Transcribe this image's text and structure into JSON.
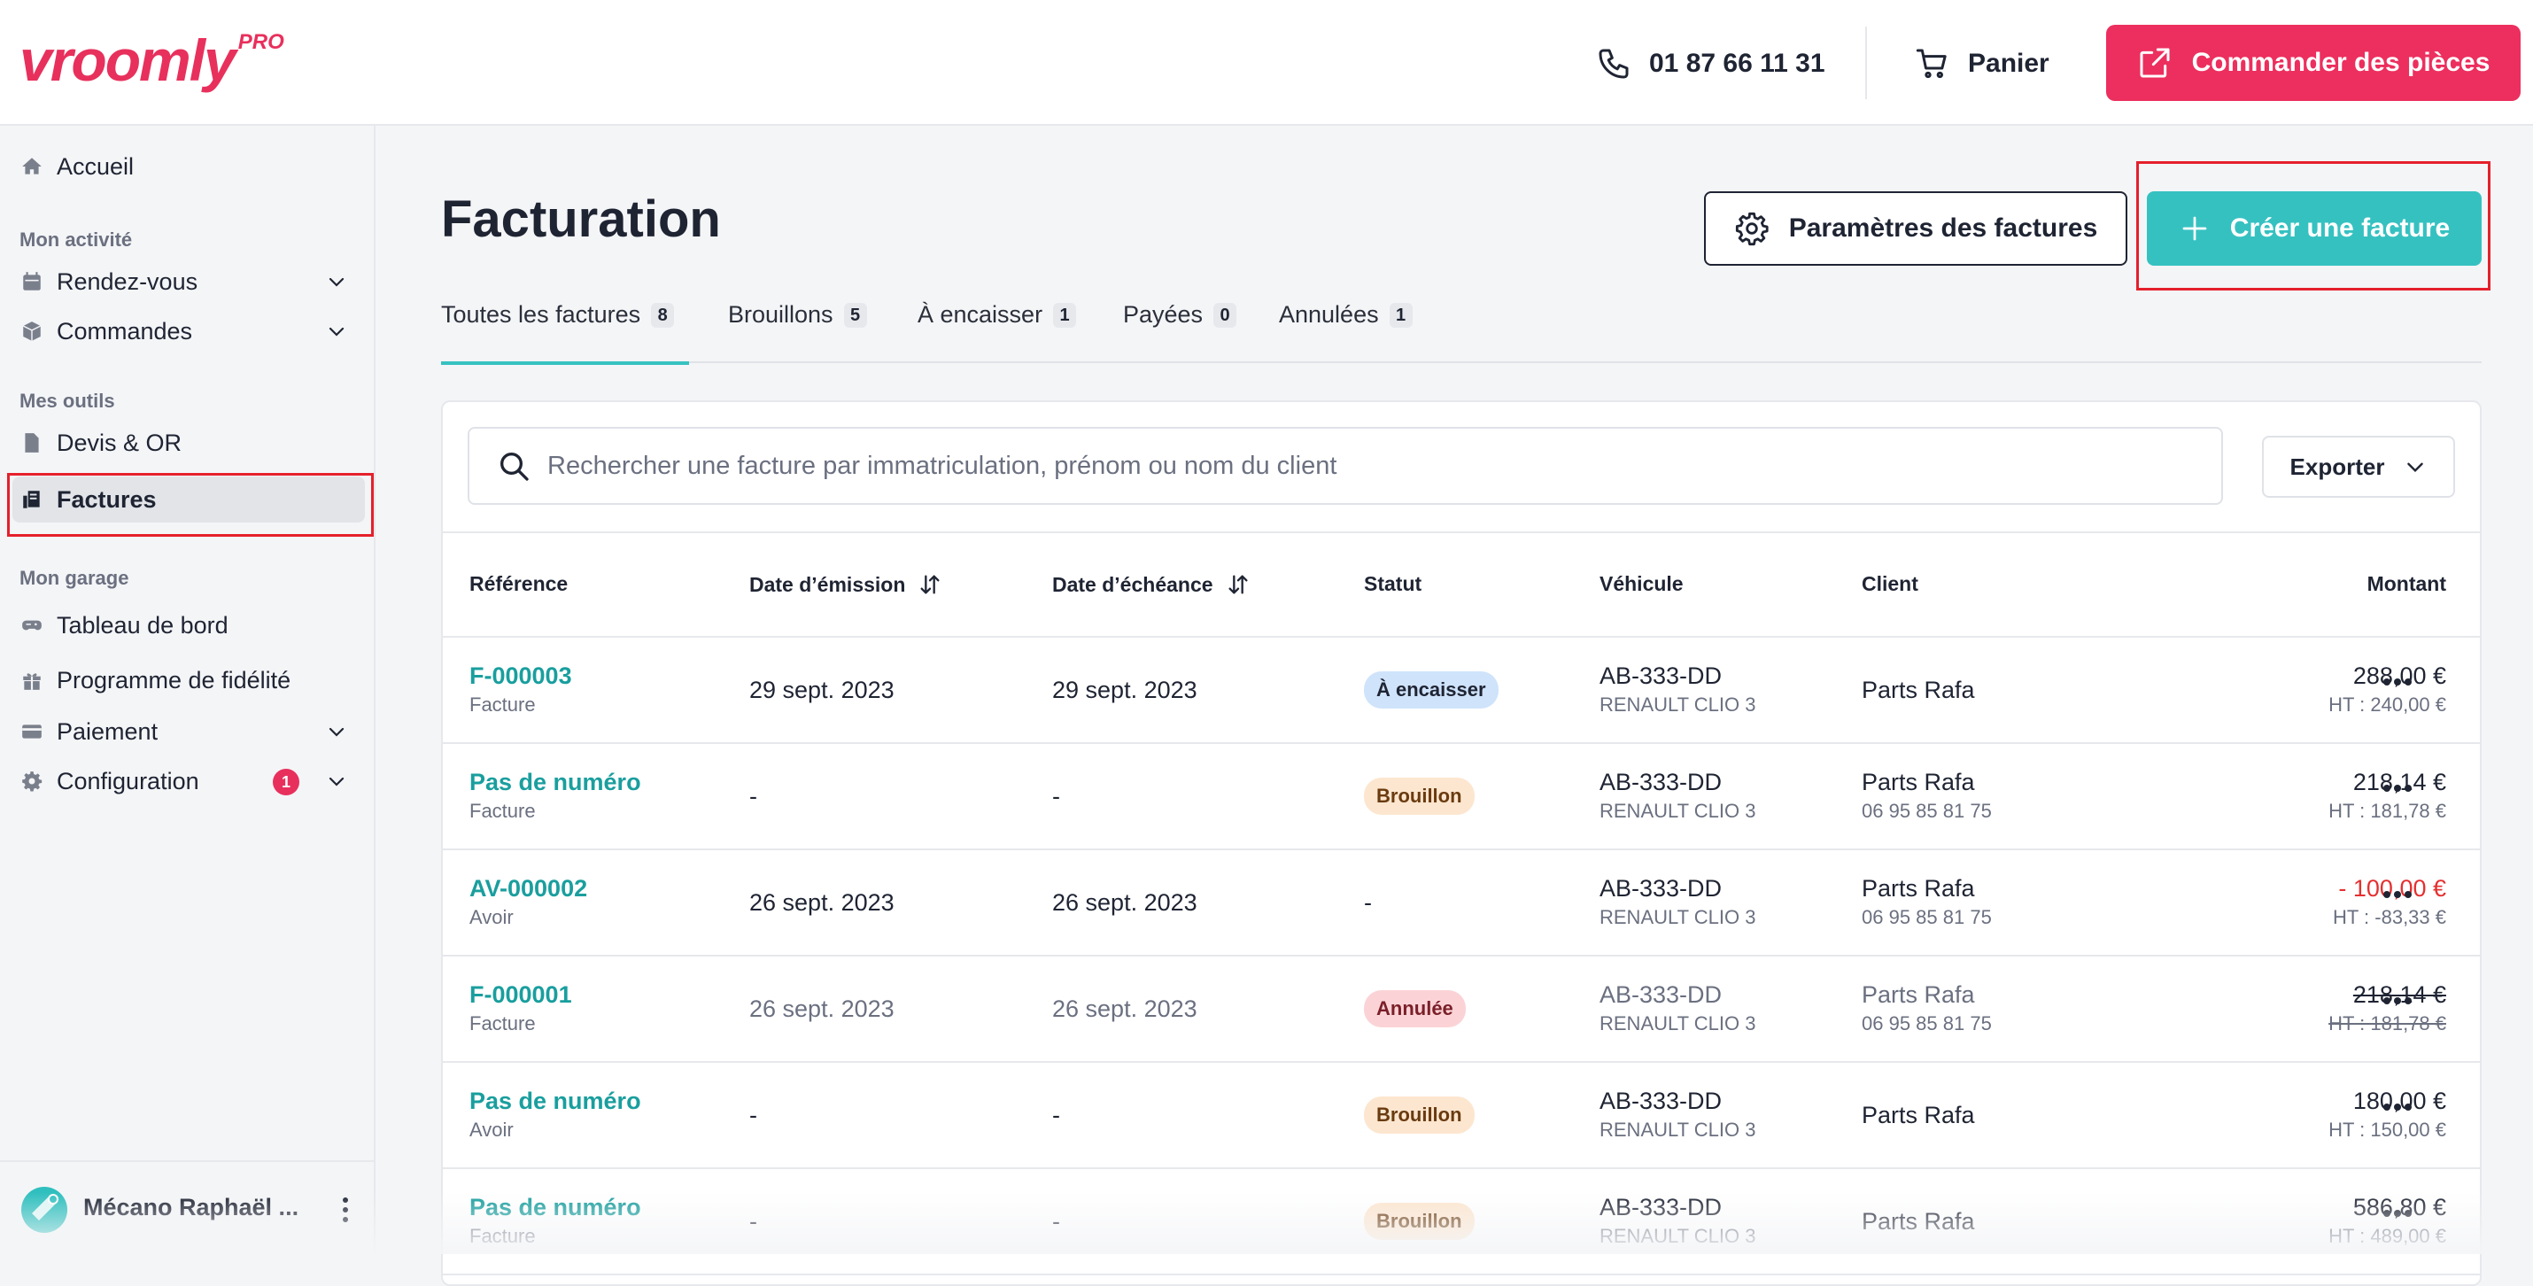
{
  "brand": {
    "name": "vroomly",
    "suffix": "PRO"
  },
  "header": {
    "phone": "01 87 66 11 31",
    "cart_label": "Panier",
    "order_label": "Commander des pièces"
  },
  "sidebar": {
    "home": "Accueil",
    "section_activity": "Mon activité",
    "rdv": "Rendez-vous",
    "orders": "Commandes",
    "section_tools": "Mes outils",
    "quotes": "Devis & OR",
    "invoices": "Factures",
    "section_garage": "Mon garage",
    "dashboard": "Tableau de bord",
    "loyalty": "Programme de fidélité",
    "payment": "Paiement",
    "config": "Configuration",
    "config_badge": "1",
    "user_name": "Mécano Raphaël ..."
  },
  "page": {
    "title": "Facturation",
    "params_label": "Paramètres des factures",
    "create_label": "Créer une facture"
  },
  "tabs": [
    {
      "label": "Toutes les factures",
      "count": "8"
    },
    {
      "label": "Brouillons",
      "count": "5"
    },
    {
      "label": "À encaisser",
      "count": "1"
    },
    {
      "label": "Payées",
      "count": "0"
    },
    {
      "label": "Annulées",
      "count": "1"
    }
  ],
  "search": {
    "placeholder": "Rechercher une facture par immatriculation, prénom ou nom du client"
  },
  "export_label": "Exporter",
  "table": {
    "headers": {
      "ref": "Référence",
      "issued": "Date d’émission",
      "due": "Date d’échéance",
      "status": "Statut",
      "vehicle": "Véhicule",
      "client": "Client",
      "amount": "Montant"
    },
    "rows": [
      {
        "ref": "F-000003",
        "type": "Facture",
        "issued": "29 sept. 2023",
        "due": "29 sept. 2023",
        "status": "À encaisser",
        "plate": "AB-333-DD",
        "model": "RENAULT CLIO 3",
        "client": "Parts Rafa",
        "phone": "",
        "amount": "288,00 €",
        "ht": "HT : 240,00 €"
      },
      {
        "ref": "Pas de numéro",
        "type": "Facture",
        "issued": "-",
        "due": "-",
        "status": "Brouillon",
        "plate": "AB-333-DD",
        "model": "RENAULT CLIO 3",
        "client": "Parts Rafa",
        "phone": "06 95 85 81 75",
        "amount": "218,14 €",
        "ht": "HT : 181,78 €"
      },
      {
        "ref": "AV-000002",
        "type": "Avoir",
        "issued": "26 sept. 2023",
        "due": "26 sept. 2023",
        "status": "-",
        "plate": "AB-333-DD",
        "model": "RENAULT CLIO 3",
        "client": "Parts Rafa",
        "phone": "06 95 85 81 75",
        "amount": "- 100,00 €",
        "ht": "HT : -83,33 €"
      },
      {
        "ref": "F-000001",
        "type": "Facture",
        "issued": "26 sept. 2023",
        "due": "26 sept. 2023",
        "status": "Annulée",
        "plate": "AB-333-DD",
        "model": "RENAULT CLIO 3",
        "client": "Parts Rafa",
        "phone": "06 95 85 81 75",
        "amount": "218,14 €",
        "ht": "HT : 181,78 €"
      },
      {
        "ref": "Pas de numéro",
        "type": "Avoir",
        "issued": "-",
        "due": "-",
        "status": "Brouillon",
        "plate": "AB-333-DD",
        "model": "RENAULT CLIO 3",
        "client": "Parts Rafa",
        "phone": "",
        "amount": "180,00 €",
        "ht": "HT : 150,00 €"
      },
      {
        "ref": "Pas de numéro",
        "type": "Facture",
        "issued": "-",
        "due": "-",
        "status": "Brouillon",
        "plate": "AB-333-DD",
        "model": "RENAULT CLIO 3",
        "client": "Parts Rafa",
        "phone": "",
        "amount": "586,80 €",
        "ht": "HT : 489,00 €"
      }
    ]
  },
  "colors": {
    "brand": "#e8305c",
    "accent": "#36c1c1",
    "link": "#1a9e9e",
    "negative": "#e53030"
  }
}
